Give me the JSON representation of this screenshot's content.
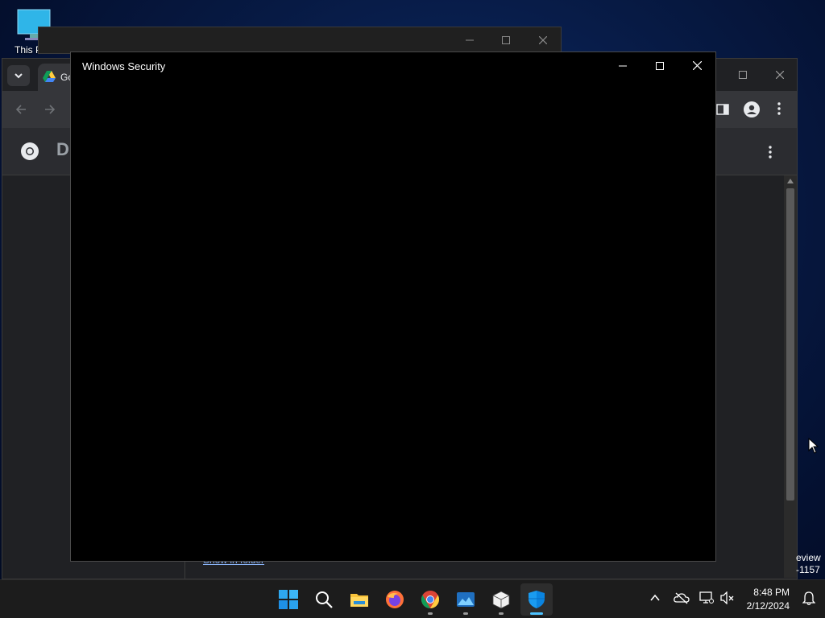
{
  "desktop": {
    "icon_label": "This PC"
  },
  "browser": {
    "tab_title": "Go",
    "page_heading_partial": "D",
    "link_text": "Show in folder"
  },
  "windows_security": {
    "title": "Windows Security"
  },
  "edge_text": {
    "line1": "eview",
    "line2": "-1157"
  },
  "taskbar": {
    "apps": [
      "start",
      "search",
      "file-explorer",
      "firefox",
      "chrome",
      "photos",
      "package",
      "windows-security"
    ],
    "time": "8:48 PM",
    "date": "2/12/2024"
  },
  "colors": {
    "accent": "#4cc2ff",
    "security_blue": "#0a84e0"
  }
}
